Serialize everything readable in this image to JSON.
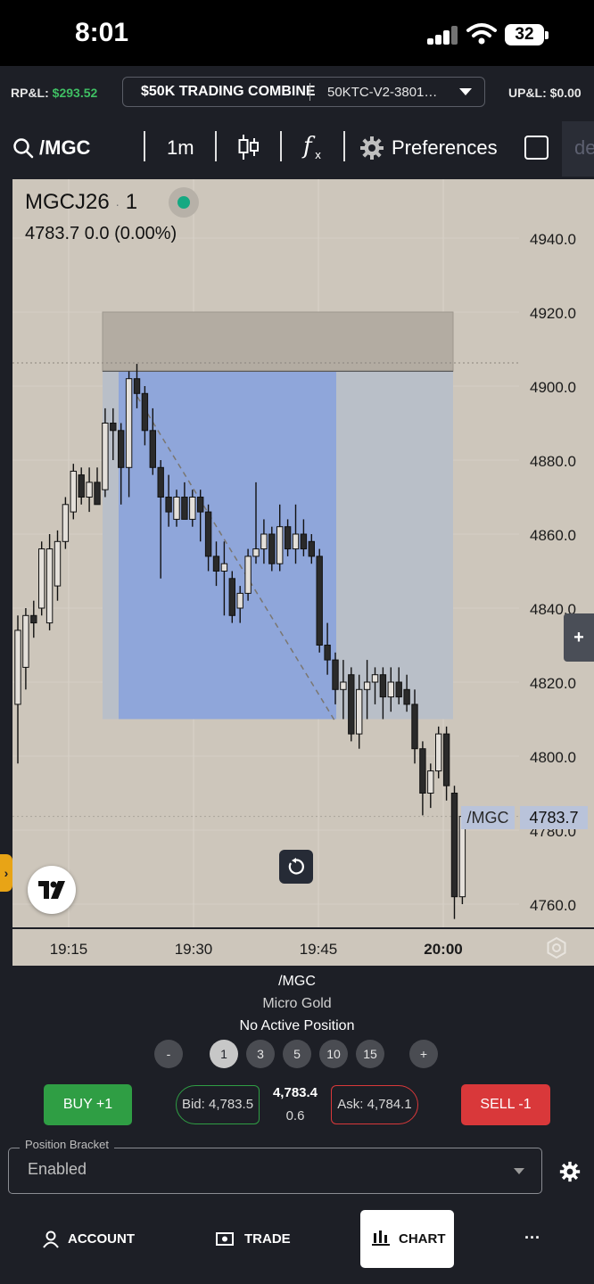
{
  "status_bar": {
    "time": "8:01",
    "battery": "32",
    "icons": [
      "signal-icon",
      "wifi-icon",
      "battery-icon"
    ]
  },
  "account_bar": {
    "rpl_label": "RP&L:",
    "rpl_value": "$293.52",
    "combine_name": "$50K TRADING COMBINE",
    "combine_account": "50KTC-V2-3801…",
    "upl_label": "UP&L:",
    "upl_value": "$0.00"
  },
  "toolbar": {
    "symbol": "/MGC",
    "interval": "1m",
    "preferences": "Preferences",
    "cut_text": "de"
  },
  "chart_header": {
    "contract": "MGCJ26",
    "interval": "1",
    "price": "4783.7",
    "change": "0.0",
    "change_pct": "(0.00%)"
  },
  "price_tag": {
    "symbol": "/MGC",
    "price": "4783.7"
  },
  "chart_data": {
    "type": "candlestick",
    "y_axis_ticks": [
      "4940.0",
      "4920.0",
      "4900.0",
      "4880.0",
      "4860.0",
      "4840.0",
      "4820.0",
      "4800.0",
      "4780.0",
      "4760.0"
    ],
    "x_axis_ticks": [
      "19:15",
      "19:30",
      "19:45",
      "20:00"
    ],
    "ylim": [
      4744,
      4953
    ],
    "last_price": 4783.7,
    "candles": [
      {
        "o": 4814,
        "h": 4838,
        "l": 4798,
        "c": 4834
      },
      {
        "o": 4824,
        "h": 4840,
        "l": 4818,
        "c": 4838
      },
      {
        "o": 4838,
        "h": 4842,
        "l": 4832,
        "c": 4836
      },
      {
        "o": 4840,
        "h": 4858,
        "l": 4838,
        "c": 4856
      },
      {
        "o": 4836,
        "h": 4860,
        "l": 4834,
        "c": 4856
      },
      {
        "o": 4846,
        "h": 4861,
        "l": 4842,
        "c": 4858
      },
      {
        "o": 4858,
        "h": 4870,
        "l": 4856,
        "c": 4868
      },
      {
        "o": 4866,
        "h": 4879,
        "l": 4864,
        "c": 4877
      },
      {
        "o": 4876,
        "h": 4878,
        "l": 4868,
        "c": 4870
      },
      {
        "o": 4870,
        "h": 4878,
        "l": 4866,
        "c": 4874
      },
      {
        "o": 4874,
        "h": 4878,
        "l": 4868,
        "c": 4868
      },
      {
        "o": 4872,
        "h": 4894,
        "l": 4870,
        "c": 4890
      },
      {
        "o": 4890,
        "h": 4894,
        "l": 4880,
        "c": 4888
      },
      {
        "o": 4888,
        "h": 4890,
        "l": 4868,
        "c": 4878
      },
      {
        "o": 4878,
        "h": 4904,
        "l": 4870,
        "c": 4902
      },
      {
        "o": 4902,
        "h": 4906,
        "l": 4894,
        "c": 4898
      },
      {
        "o": 4898,
        "h": 4900,
        "l": 4884,
        "c": 4888
      },
      {
        "o": 4888,
        "h": 4894,
        "l": 4876,
        "c": 4878
      },
      {
        "o": 4878,
        "h": 4880,
        "l": 4848,
        "c": 4870
      },
      {
        "o": 4870,
        "h": 4876,
        "l": 4862,
        "c": 4866
      },
      {
        "o": 4864,
        "h": 4872,
        "l": 4862,
        "c": 4870
      },
      {
        "o": 4870,
        "h": 4874,
        "l": 4864,
        "c": 4864
      },
      {
        "o": 4864,
        "h": 4872,
        "l": 4862,
        "c": 4870
      },
      {
        "o": 4870,
        "h": 4872,
        "l": 4858,
        "c": 4866
      },
      {
        "o": 4866,
        "h": 4868,
        "l": 4850,
        "c": 4854
      },
      {
        "o": 4854,
        "h": 4858,
        "l": 4846,
        "c": 4850
      },
      {
        "o": 4850,
        "h": 4858,
        "l": 4838,
        "c": 4852
      },
      {
        "o": 4848,
        "h": 4850,
        "l": 4836,
        "c": 4838
      },
      {
        "o": 4840,
        "h": 4846,
        "l": 4836,
        "c": 4844
      },
      {
        "o": 4844,
        "h": 4856,
        "l": 4842,
        "c": 4854
      },
      {
        "o": 4854,
        "h": 4874,
        "l": 4852,
        "c": 4856
      },
      {
        "o": 4856,
        "h": 4864,
        "l": 4852,
        "c": 4860
      },
      {
        "o": 4860,
        "h": 4862,
        "l": 4850,
        "c": 4852
      },
      {
        "o": 4852,
        "h": 4868,
        "l": 4850,
        "c": 4862
      },
      {
        "o": 4862,
        "h": 4864,
        "l": 4854,
        "c": 4856
      },
      {
        "o": 4856,
        "h": 4868,
        "l": 4852,
        "c": 4860
      },
      {
        "o": 4860,
        "h": 4864,
        "l": 4854,
        "c": 4856
      },
      {
        "o": 4858,
        "h": 4860,
        "l": 4852,
        "c": 4854
      },
      {
        "o": 4854,
        "h": 4856,
        "l": 4828,
        "c": 4830
      },
      {
        "o": 4830,
        "h": 4836,
        "l": 4822,
        "c": 4826
      },
      {
        "o": 4826,
        "h": 4828,
        "l": 4814,
        "c": 4818
      },
      {
        "o": 4818,
        "h": 4826,
        "l": 4810,
        "c": 4820
      },
      {
        "o": 4822,
        "h": 4824,
        "l": 4804,
        "c": 4806
      },
      {
        "o": 4806,
        "h": 4822,
        "l": 4802,
        "c": 4818
      },
      {
        "o": 4818,
        "h": 4826,
        "l": 4810,
        "c": 4820
      },
      {
        "o": 4820,
        "h": 4824,
        "l": 4814,
        "c": 4822
      },
      {
        "o": 4822,
        "h": 4824,
        "l": 4810,
        "c": 4816
      },
      {
        "o": 4816,
        "h": 4824,
        "l": 4812,
        "c": 4820
      },
      {
        "o": 4820,
        "h": 4824,
        "l": 4814,
        "c": 4816
      },
      {
        "o": 4818,
        "h": 4822,
        "l": 4812,
        "c": 4814
      },
      {
        "o": 4814,
        "h": 4818,
        "l": 4798,
        "c": 4802
      },
      {
        "o": 4802,
        "h": 4804,
        "l": 4784,
        "c": 4790
      },
      {
        "o": 4790,
        "h": 4798,
        "l": 4786,
        "c": 4796
      },
      {
        "o": 4796,
        "h": 4808,
        "l": 4794,
        "c": 4806
      },
      {
        "o": 4806,
        "h": 4808,
        "l": 4788,
        "c": 4792
      },
      {
        "o": 4790,
        "h": 4792,
        "l": 4756,
        "c": 4762
      },
      {
        "o": 4762,
        "h": 4784,
        "l": 4760,
        "c": 4783.7
      }
    ],
    "long_position_tool": {
      "entry": 4904,
      "target": 4920,
      "stop": 4810
    }
  },
  "instrument": {
    "symbol": "/MGC",
    "name": "Micro Gold",
    "position": "No Active Position"
  },
  "quantity": {
    "minus": "-",
    "plus": "+",
    "options": [
      "1",
      "3",
      "5",
      "10",
      "15"
    ]
  },
  "order": {
    "buy_label": "BUY +1",
    "sell_label": "SELL -1",
    "bid": "Bid: 4,783.5",
    "ask": "Ask: 4,784.1",
    "last": "4,783.4",
    "spread": "0.6"
  },
  "bracket": {
    "label": "Position Bracket",
    "value": "Enabled"
  },
  "nav": {
    "account": "ACCOUNT",
    "trade": "TRADE",
    "chart": "CHART",
    "more": "···"
  },
  "colors": {
    "profit": "#3fbf63",
    "buy": "#2f9e44",
    "sell": "#d9383a",
    "chart_bg": "#cdc6bb",
    "range_blue": "#7f9fe0",
    "live_dot": "#15a982"
  }
}
